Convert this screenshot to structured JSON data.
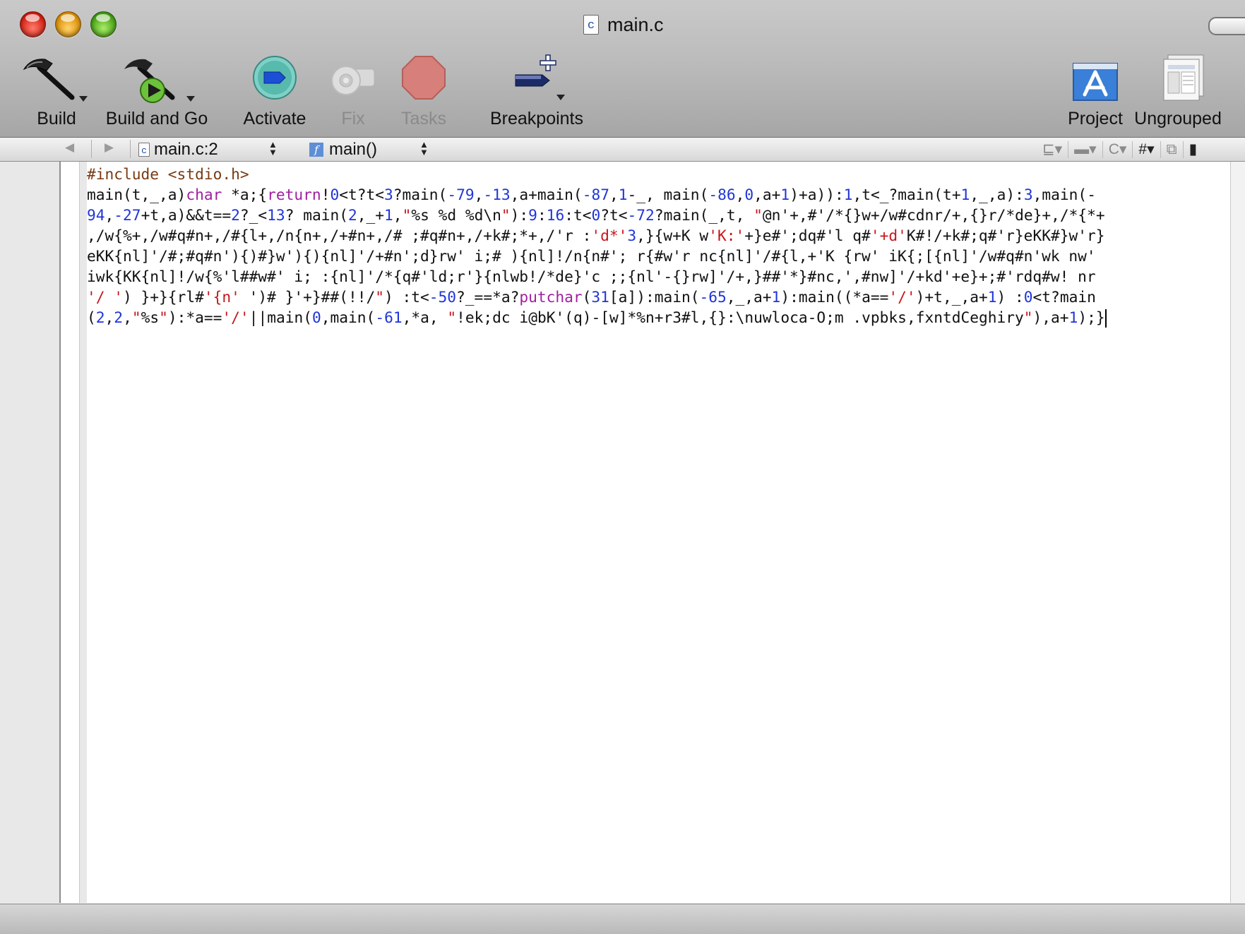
{
  "window": {
    "title": "main.c",
    "title_icon": "c-source-file-icon"
  },
  "toolbar": {
    "items": [
      {
        "label": "Build",
        "icon": "hammer-icon",
        "enabled": true
      },
      {
        "label": "Build and Go",
        "icon": "build-and-go-icon",
        "enabled": true
      },
      {
        "label": "Activate",
        "icon": "activate-icon",
        "enabled": true
      },
      {
        "label": "Fix",
        "icon": "fix-icon",
        "enabled": false
      },
      {
        "label": "Tasks",
        "icon": "stop-icon",
        "enabled": false
      },
      {
        "label": "Breakpoints",
        "icon": "breakpoints-icon",
        "enabled": true
      },
      {
        "label": "Project",
        "icon": "project-icon",
        "enabled": true
      },
      {
        "label": "Ungrouped",
        "icon": "ungrouped-icon",
        "enabled": true
      }
    ]
  },
  "navbar": {
    "file_popup": "main.c:2",
    "function_popup": "main()",
    "right_buttons": [
      "bookmarks",
      "breakpoints",
      "C",
      "#",
      "split"
    ]
  },
  "editor": {
    "lines": [
      "#include <stdio.h>",
      "main(t,_,a)char *a;{return!0<t?t<3?main(-79,-13,a+main(-87,1-_, main(-86,0,a+1)+a)):1,t<_?main(t+1,_,a):3,main(-",
      "94,-27+t,a)&&t==2?_<13? main(2,_+1,\"%s %d %d\\n\"):9:16:t<0?t<-72?main(_,t, \"@n'+,#'/*{}w+/w#cdnr/+,{}r/*de}+,/*{*+",
      ",/w{%+,/w#q#n+,/#{l+,/n{n+,/+#n+,/# ;#q#n+,/+k#;*+,/'r :'d*'3,}{w+K w'K:'+}e#';dq#'l q#'+d'K#!/+k#;q#'r}eKK#}w'r}",
      "eKK{nl]'/#;#q#n'){)#}w'){){nl]'/+#n';d}rw' i;# ){nl]!/n{n#'; r{#w'r nc{nl]'/#{l,+'K {rw' iK{;[{nl]'/w#q#n'wk nw'",
      "iwk{KK{nl]!/w{%'l##w#' i; :{nl]'/*{q#'ld;r'}{nlwb!/*de}'c ;;{nl'-{}rw]'/+,}##'*}#nc,',#nw]'/+kd'+e}+;#'rdq#w! nr",
      "'/ ') }+}{rl#'{n' ')# }'+}##(!!/\") :t<-50?_==*a?putchar(31[a]):main(-65,_,a+1):main((*a=='/')+t,_,a+1) :0<t?main",
      "(2,2,\"%s\"):*a=='/'||main(0,main(-61,*a, \"!ek;dc i@bK'(q)-[w]*%n+r3#l,{}:\\nuwloca-O;m .vpbks,fxntdCeghiry\"),a+1);}"
    ]
  }
}
